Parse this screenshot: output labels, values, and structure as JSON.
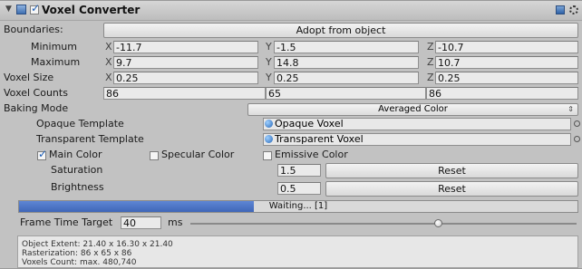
{
  "component": {
    "title": "Voxel Converter",
    "enabled": true,
    "expanded": true,
    "icons": {
      "foldout": "triangle-down-icon",
      "component": "cube-script-icon",
      "help": "book-help-icon",
      "settings": "gear-icon"
    }
  },
  "boundaries": {
    "label": "Boundaries:",
    "button_label": "Adopt from object",
    "minimum": {
      "label": "Minimum",
      "x_axis": "X",
      "x": "-11.7",
      "y_axis": "Y",
      "y": "-1.5",
      "z_axis": "Z",
      "z": "-10.7"
    },
    "maximum": {
      "label": "Maximum",
      "x_axis": "X",
      "x": "9.7",
      "y_axis": "Y",
      "y": "14.8",
      "z_axis": "Z",
      "z": "10.7"
    }
  },
  "voxel_size": {
    "label": "Voxel Size",
    "x_axis": "X",
    "x": "0.25",
    "y_axis": "Y",
    "y": "0.25",
    "z_axis": "Z",
    "z": "0.25"
  },
  "voxel_counts": {
    "label": "Voxel Counts",
    "x": "86",
    "y": "65",
    "z": "86"
  },
  "baking": {
    "label": "Baking Mode",
    "selected": "Averaged Color"
  },
  "templates": {
    "opaque_label": "Opaque Template",
    "opaque_value": "Opaque Voxel",
    "transparent_label": "Transparent Template",
    "transparent_value": "Transparent Voxel"
  },
  "colors": {
    "main_label": "Main Color",
    "main_checked": true,
    "specular_label": "Specular Color",
    "specular_checked": false,
    "emissive_label": "Emissive Color",
    "emissive_checked": false
  },
  "saturation": {
    "label": "Saturation",
    "value": "1.5",
    "reset_label": "Reset"
  },
  "brightness": {
    "label": "Brightness",
    "value": "0.5",
    "reset_label": "Reset"
  },
  "progress": {
    "text": "Waiting... [1]",
    "fraction": 0.42
  },
  "frame_time": {
    "label": "Frame Time Target",
    "value": "40",
    "unit": "ms",
    "slider_fraction": 0.64
  },
  "info": {
    "line1": "Object Extent: 21.40 x 16.30 x 21.40",
    "line2": "Rasterization: 86 x 65 x 86",
    "line3": "Voxels Count: max. 480,740"
  },
  "colors_theme": {
    "panel": "#c2c2c2",
    "progress": "#4a72c4",
    "field": "#eaeaea"
  }
}
